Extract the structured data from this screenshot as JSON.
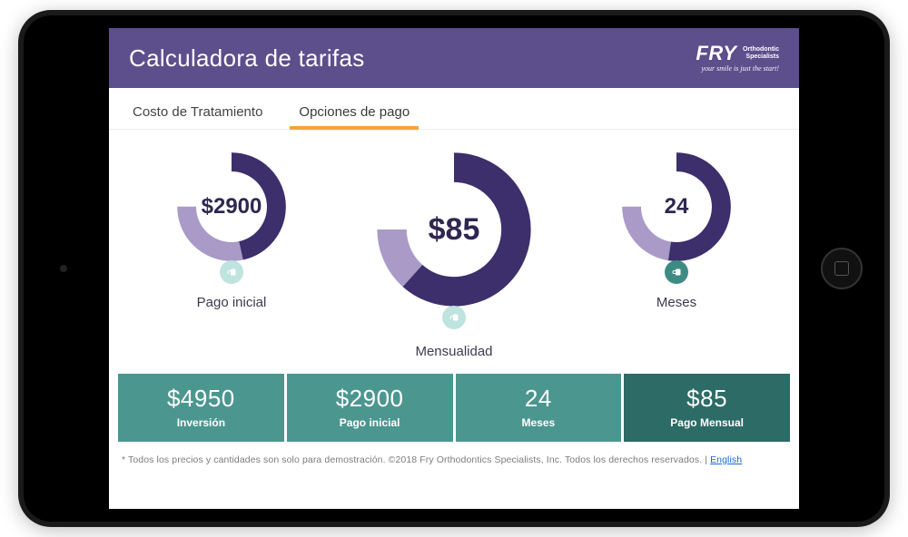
{
  "header": {
    "title": "Calculadora de tarifas",
    "brand_main": "FRY",
    "brand_sub1": "Orthodontic",
    "brand_sub2": "Specialists",
    "brand_tagline": "your smile is just the start!"
  },
  "tabs": {
    "treatment": "Costo de Tratamiento",
    "payment": "Opciones de pago",
    "active": "payment"
  },
  "gauges": {
    "down_payment": {
      "value": "$2900",
      "label": "Pago inicial",
      "fraction": 0.62,
      "locked": false
    },
    "monthly": {
      "value": "$85",
      "label": "Mensualidad",
      "fraction": 0.82,
      "locked": false
    },
    "months": {
      "value": "24",
      "label": "Meses",
      "fraction": 0.7,
      "locked": true
    }
  },
  "summary": {
    "investment": {
      "value": "$4950",
      "label": "Inversión"
    },
    "down_payment": {
      "value": "$2900",
      "label": "Pago inicial"
    },
    "months": {
      "value": "24",
      "label": "Meses"
    },
    "monthly": {
      "value": "$85",
      "label": "Pago Mensual"
    }
  },
  "footer": {
    "text": "* Todos los precios y cantidades son solo para demostración. ©2018 Fry Orthodontics Specialists, Inc. Todos los derechos reservados. | ",
    "link": "English"
  },
  "colors": {
    "header_bg": "#5d4e8c",
    "tab_underline": "#f2a43a",
    "gauge_track": "#a99ac7",
    "gauge_fill": "#3c2f6b",
    "summary_bg": "#4c9690",
    "summary_bg_dark": "#2c6b66"
  }
}
